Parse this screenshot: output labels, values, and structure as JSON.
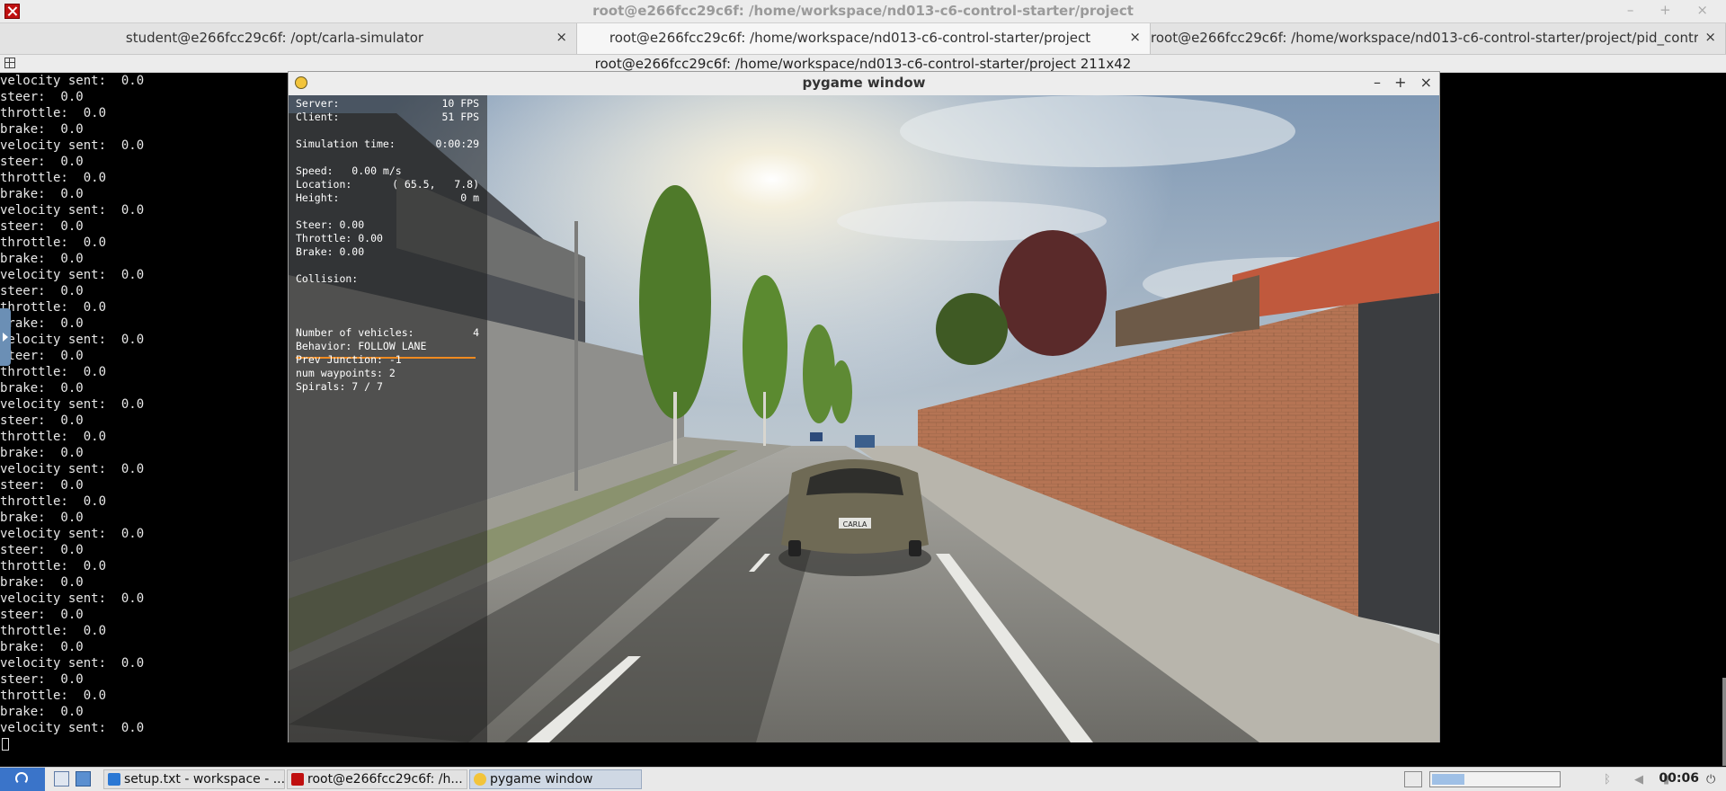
{
  "app": {
    "title": "root@e266fcc29c6f: /home/workspace/nd013-c6-control-starter/project",
    "controls": "– + ×"
  },
  "tabs": [
    {
      "label": "student@e266fcc29c6f: /opt/carla-simulator",
      "close": "×",
      "active": false
    },
    {
      "label": "root@e266fcc29c6f: /home/workspace/nd013-c6-control-starter/project",
      "close": "×",
      "active": true
    },
    {
      "label": "root@e266fcc29c6f: /home/workspace/nd013-c6-control-starter/project/pid_controller",
      "close": "×",
      "active": false
    }
  ],
  "terminal": {
    "header": "root@e266fcc29c6f: /home/workspace/nd013-c6-control-starter/project 211x42",
    "lines": [
      "velocity sent:  0.0",
      "steer:  0.0",
      "throttle:  0.0",
      "brake:  0.0",
      "velocity sent:  0.0",
      "steer:  0.0",
      "throttle:  0.0",
      "brake:  0.0",
      "velocity sent:  0.0",
      "steer:  0.0",
      "throttle:  0.0",
      "brake:  0.0",
      "velocity sent:  0.0",
      "steer:  0.0",
      "throttle:  0.0",
      "brake:  0.0",
      "velocity sent:  0.0",
      "steer:  0.0",
      "throttle:  0.0",
      "brake:  0.0",
      "velocity sent:  0.0",
      "steer:  0.0",
      "throttle:  0.0",
      "brake:  0.0",
      "velocity sent:  0.0",
      "steer:  0.0",
      "throttle:  0.0",
      "brake:  0.0",
      "velocity sent:  0.0",
      "steer:  0.0",
      "throttle:  0.0",
      "brake:  0.0",
      "velocity sent:  0.0",
      "steer:  0.0",
      "throttle:  0.0",
      "brake:  0.0",
      "velocity sent:  0.0",
      "steer:  0.0",
      "throttle:  0.0",
      "brake:  0.0",
      "velocity sent:  0.0"
    ]
  },
  "pygame": {
    "title": "pygame window",
    "controls": [
      "–",
      "+",
      "×"
    ],
    "hud": {
      "server_label": "Server:",
      "server_value": "10 FPS",
      "client_label": "Client:",
      "client_value": "51 FPS",
      "sim_time_label": "Simulation time:",
      "sim_time_value": "0:00:29",
      "speed": "Speed:   0.00 m/s",
      "location_label": "Location:",
      "location_value": "( 65.5,   7.8)",
      "height_label": "Height:",
      "height_value": "0 m",
      "steer": "Steer: 0.00",
      "throttle": "Throttle: 0.00",
      "brake": "Brake: 0.00",
      "collision": "Collision:",
      "vehicles_label": "Number of vehicles:",
      "vehicles_value": "4",
      "behavior": "Behavior: FOLLOW LANE",
      "prev_junction": "Prev Junction: -1",
      "num_waypoints": "num waypoints: 2",
      "spirals": "Spirals: 7 / 7"
    },
    "car_plate": "CARLA"
  },
  "taskbar": {
    "tasks": [
      {
        "label": "setup.txt - workspace - ...",
        "active": false
      },
      {
        "label": "root@e266fcc29c6f: /h...",
        "active": false
      },
      {
        "label": "pygame window",
        "active": true
      }
    ],
    "clock": "00:06"
  },
  "colors": {
    "accent_bar": "#f08a20",
    "start": "#3a74c9"
  }
}
